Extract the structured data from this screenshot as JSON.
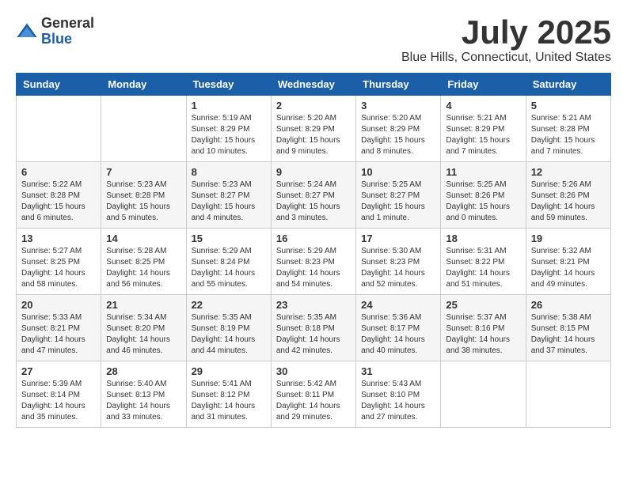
{
  "logo": {
    "general": "General",
    "blue": "Blue"
  },
  "title": {
    "month": "July 2025",
    "location": "Blue Hills, Connecticut, United States"
  },
  "days_of_week": [
    "Sunday",
    "Monday",
    "Tuesday",
    "Wednesday",
    "Thursday",
    "Friday",
    "Saturday"
  ],
  "weeks": [
    [
      {
        "day": "",
        "info": ""
      },
      {
        "day": "",
        "info": ""
      },
      {
        "day": "1",
        "info": "Sunrise: 5:19 AM\nSunset: 8:29 PM\nDaylight: 15 hours and 10 minutes."
      },
      {
        "day": "2",
        "info": "Sunrise: 5:20 AM\nSunset: 8:29 PM\nDaylight: 15 hours and 9 minutes."
      },
      {
        "day": "3",
        "info": "Sunrise: 5:20 AM\nSunset: 8:29 PM\nDaylight: 15 hours and 8 minutes."
      },
      {
        "day": "4",
        "info": "Sunrise: 5:21 AM\nSunset: 8:29 PM\nDaylight: 15 hours and 7 minutes."
      },
      {
        "day": "5",
        "info": "Sunrise: 5:21 AM\nSunset: 8:28 PM\nDaylight: 15 hours and 7 minutes."
      }
    ],
    [
      {
        "day": "6",
        "info": "Sunrise: 5:22 AM\nSunset: 8:28 PM\nDaylight: 15 hours and 6 minutes."
      },
      {
        "day": "7",
        "info": "Sunrise: 5:23 AM\nSunset: 8:28 PM\nDaylight: 15 hours and 5 minutes."
      },
      {
        "day": "8",
        "info": "Sunrise: 5:23 AM\nSunset: 8:27 PM\nDaylight: 15 hours and 4 minutes."
      },
      {
        "day": "9",
        "info": "Sunrise: 5:24 AM\nSunset: 8:27 PM\nDaylight: 15 hours and 3 minutes."
      },
      {
        "day": "10",
        "info": "Sunrise: 5:25 AM\nSunset: 8:27 PM\nDaylight: 15 hours and 1 minute."
      },
      {
        "day": "11",
        "info": "Sunrise: 5:25 AM\nSunset: 8:26 PM\nDaylight: 15 hours and 0 minutes."
      },
      {
        "day": "12",
        "info": "Sunrise: 5:26 AM\nSunset: 8:26 PM\nDaylight: 14 hours and 59 minutes."
      }
    ],
    [
      {
        "day": "13",
        "info": "Sunrise: 5:27 AM\nSunset: 8:25 PM\nDaylight: 14 hours and 58 minutes."
      },
      {
        "day": "14",
        "info": "Sunrise: 5:28 AM\nSunset: 8:25 PM\nDaylight: 14 hours and 56 minutes."
      },
      {
        "day": "15",
        "info": "Sunrise: 5:29 AM\nSunset: 8:24 PM\nDaylight: 14 hours and 55 minutes."
      },
      {
        "day": "16",
        "info": "Sunrise: 5:29 AM\nSunset: 8:23 PM\nDaylight: 14 hours and 54 minutes."
      },
      {
        "day": "17",
        "info": "Sunrise: 5:30 AM\nSunset: 8:23 PM\nDaylight: 14 hours and 52 minutes."
      },
      {
        "day": "18",
        "info": "Sunrise: 5:31 AM\nSunset: 8:22 PM\nDaylight: 14 hours and 51 minutes."
      },
      {
        "day": "19",
        "info": "Sunrise: 5:32 AM\nSunset: 8:21 PM\nDaylight: 14 hours and 49 minutes."
      }
    ],
    [
      {
        "day": "20",
        "info": "Sunrise: 5:33 AM\nSunset: 8:21 PM\nDaylight: 14 hours and 47 minutes."
      },
      {
        "day": "21",
        "info": "Sunrise: 5:34 AM\nSunset: 8:20 PM\nDaylight: 14 hours and 46 minutes."
      },
      {
        "day": "22",
        "info": "Sunrise: 5:35 AM\nSunset: 8:19 PM\nDaylight: 14 hours and 44 minutes."
      },
      {
        "day": "23",
        "info": "Sunrise: 5:35 AM\nSunset: 8:18 PM\nDaylight: 14 hours and 42 minutes."
      },
      {
        "day": "24",
        "info": "Sunrise: 5:36 AM\nSunset: 8:17 PM\nDaylight: 14 hours and 40 minutes."
      },
      {
        "day": "25",
        "info": "Sunrise: 5:37 AM\nSunset: 8:16 PM\nDaylight: 14 hours and 38 minutes."
      },
      {
        "day": "26",
        "info": "Sunrise: 5:38 AM\nSunset: 8:15 PM\nDaylight: 14 hours and 37 minutes."
      }
    ],
    [
      {
        "day": "27",
        "info": "Sunrise: 5:39 AM\nSunset: 8:14 PM\nDaylight: 14 hours and 35 minutes."
      },
      {
        "day": "28",
        "info": "Sunrise: 5:40 AM\nSunset: 8:13 PM\nDaylight: 14 hours and 33 minutes."
      },
      {
        "day": "29",
        "info": "Sunrise: 5:41 AM\nSunset: 8:12 PM\nDaylight: 14 hours and 31 minutes."
      },
      {
        "day": "30",
        "info": "Sunrise: 5:42 AM\nSunset: 8:11 PM\nDaylight: 14 hours and 29 minutes."
      },
      {
        "day": "31",
        "info": "Sunrise: 5:43 AM\nSunset: 8:10 PM\nDaylight: 14 hours and 27 minutes."
      },
      {
        "day": "",
        "info": ""
      },
      {
        "day": "",
        "info": ""
      }
    ]
  ]
}
